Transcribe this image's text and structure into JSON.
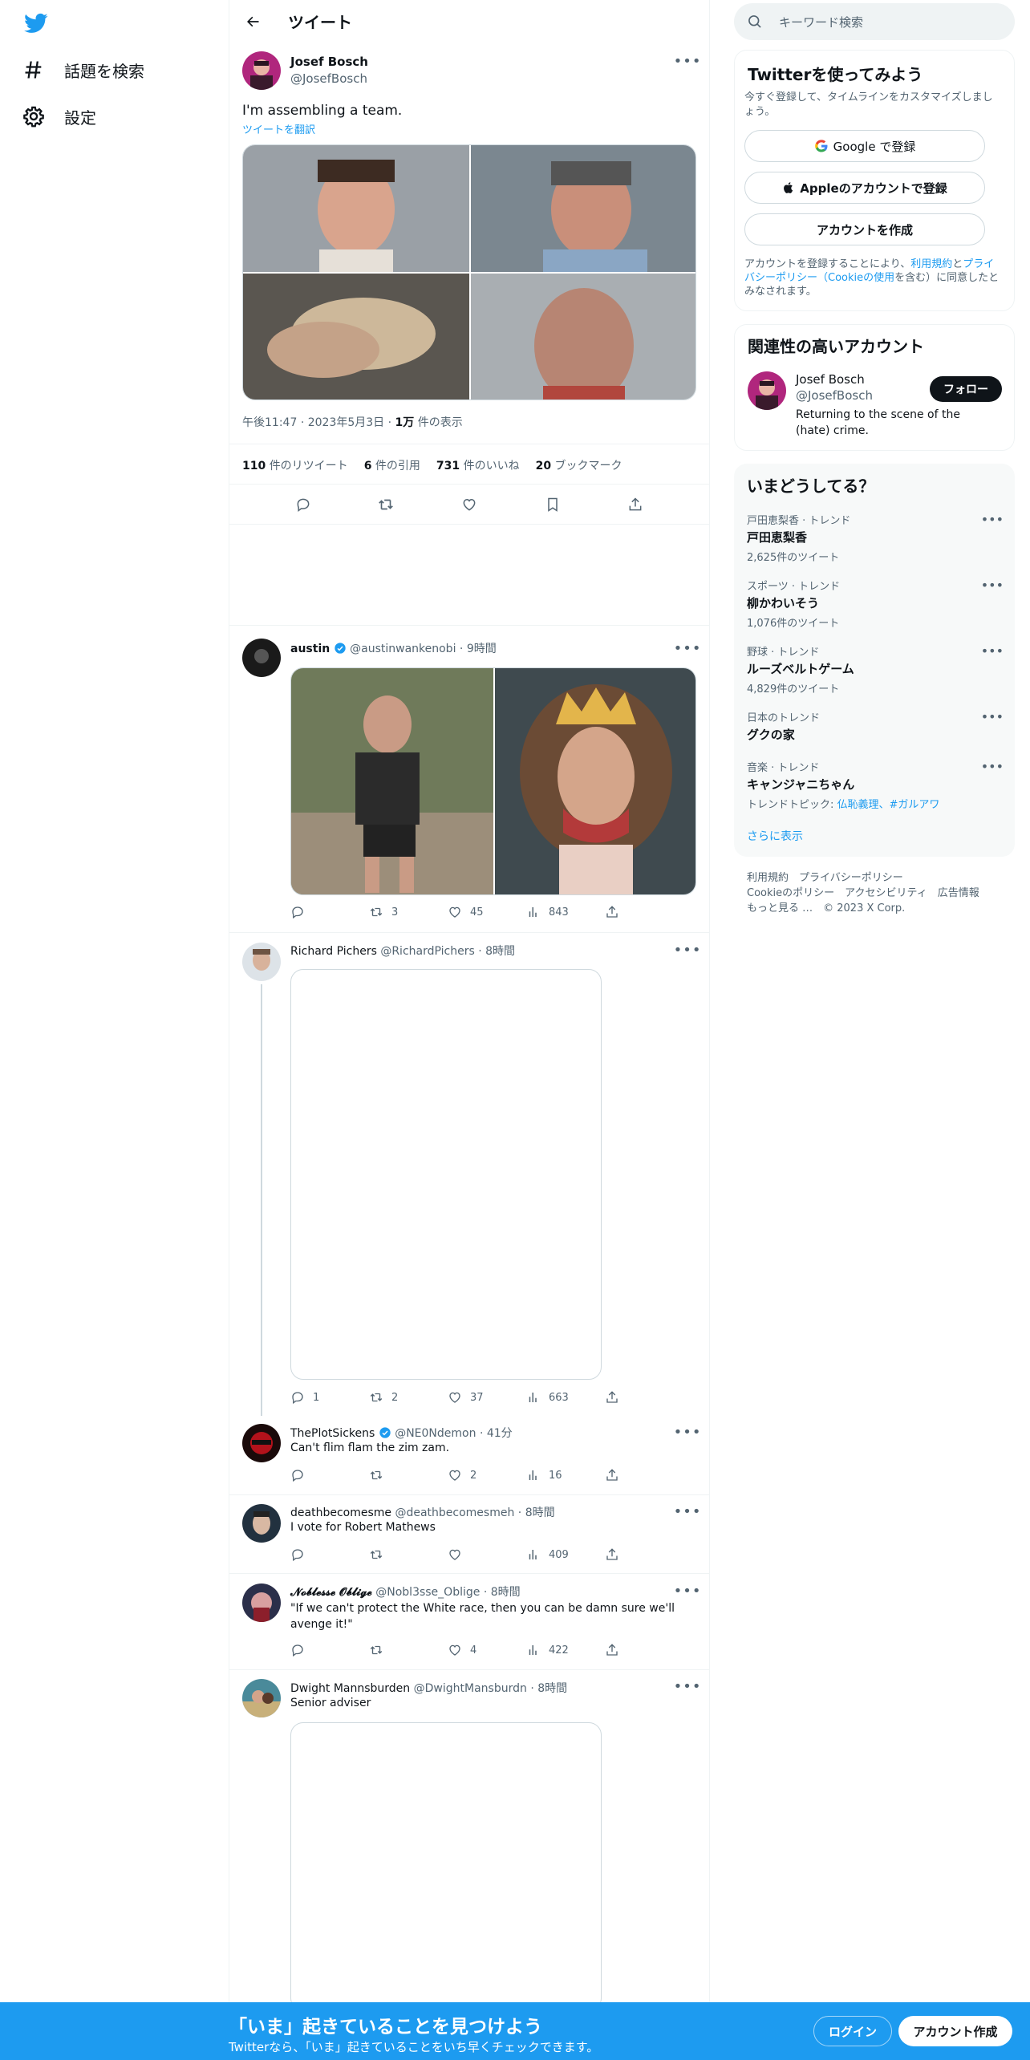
{
  "nav": {
    "explore_label": "話題を検索",
    "settings_label": "設定"
  },
  "header": {
    "title": "ツイート"
  },
  "main_tweet": {
    "name": "Josef Bosch",
    "handle": "@JosefBosch",
    "text": "I'm assembling a team.",
    "translate_label": "ツイートを翻訳",
    "time": "午後11:47",
    "date": "2023年5月3日",
    "views_count": "1万",
    "views_label": "件の表示",
    "retweets_count": "110",
    "retweets_label": "件のリツイート",
    "quotes_count": "6",
    "quotes_label": "件の引用",
    "likes_count": "731",
    "likes_label": "件のいいね",
    "bookmarks_count": "20",
    "bookmarks_label": "ブックマーク",
    "sep": "·"
  },
  "replies": [
    {
      "name": "austin",
      "handle": "@austinwankenobi",
      "time": "9時間",
      "text": "",
      "replies": "",
      "retweets": "3",
      "likes": "45",
      "views": "843"
    },
    {
      "name": "Richard Pichers",
      "handle": "@RichardPichers",
      "time": "8時間",
      "text": "",
      "replies": "1",
      "retweets": "2",
      "likes": "37",
      "views": "663"
    },
    {
      "name": "ThePlotSickens",
      "handle": "@NE0Ndemon",
      "time": "41分",
      "text": "Can't flim flam the zim zam.",
      "replies": "",
      "retweets": "",
      "likes": "2",
      "views": "16"
    },
    {
      "name": "deathbecomesme",
      "handle": "@deathbecomesmeh",
      "time": "8時間",
      "text": "I vote for Robert Mathews",
      "replies": "",
      "retweets": "",
      "likes": "",
      "views": "409"
    },
    {
      "name": "𝓝𝓸𝓫𝓵𝓮𝓼𝓼𝓮 𝓞𝓫𝓵𝓲𝓰𝓮",
      "handle": "@Nobl3sse_Oblige",
      "time": "8時間",
      "text": "\"If we can't protect  the White race, then you can be damn sure we'll avenge it!\"",
      "replies": "",
      "retweets": "",
      "likes": "4",
      "views": "422"
    },
    {
      "name": "Dwight Mannsburden",
      "handle": "@DwightMansburdn",
      "time": "8時間",
      "text": "Senior adviser",
      "replies": "",
      "retweets": "",
      "likes": "",
      "views": ""
    }
  ],
  "sidebar": {
    "search_placeholder": "キーワード検索",
    "join": {
      "title": "Twitterを使ってみよう",
      "subtitle": "今すぐ登録して、タイムラインをカスタマイズしましょう。",
      "google_btn": "Google で登録",
      "apple_btn": "Appleのアカウントで登録",
      "create_btn": "アカウントを作成",
      "terms_pre": "アカウントを登録することにより、",
      "terms_link": "利用規約",
      "terms_and": "と",
      "privacy_link": "プライバシーポリシー（Cookieの使用",
      "terms_post": "を含む）に同意したとみなされます。"
    },
    "related": {
      "title": "関連性の高いアカウント",
      "name": "Josef Bosch",
      "handle": "@JosefBosch",
      "bio": "Returning to the scene of the (hate) crime.",
      "follow_btn": "フォロー"
    },
    "trends": {
      "title": "いまどうしてる？",
      "items": [
        {
          "meta": "戸田恵梨香 · トレンド",
          "topic": "戸田恵梨香",
          "count": "2,625件のツイート"
        },
        {
          "meta": "スポーツ · トレンド",
          "topic": "柳かわいそう",
          "count": "1,076件のツイート"
        },
        {
          "meta": "野球 · トレンド",
          "topic": "ルーズベルトゲーム",
          "count": "4,829件のツイート"
        },
        {
          "meta": "日本のトレンド",
          "topic": "グクの家",
          "count": ""
        },
        {
          "meta": "音楽 · トレンド",
          "topic": "キャンジャニちゃん",
          "count_pre": "トレンドトピック: ",
          "count_link": "仏恥義理、#ガルアワ"
        }
      ],
      "show_more": "さらに表示"
    },
    "footer": {
      "line1": "利用規約　プライバシーポリシー",
      "line2": "Cookieのポリシー　アクセシビリティ　広告情報",
      "line3": "もっと見る …　© 2023 X Corp."
    }
  },
  "banner": {
    "title": "「いま」起きていることを見つけよう",
    "subtitle": "Twitterなら、「いま」起きていることをいち早くチェックできます。",
    "login_btn": "ログイン",
    "signup_btn": "アカウント作成"
  },
  "colors": {
    "accent": "#1d9bf0",
    "text": "#0f1419",
    "muted": "#536471",
    "border": "#eff3f4"
  }
}
